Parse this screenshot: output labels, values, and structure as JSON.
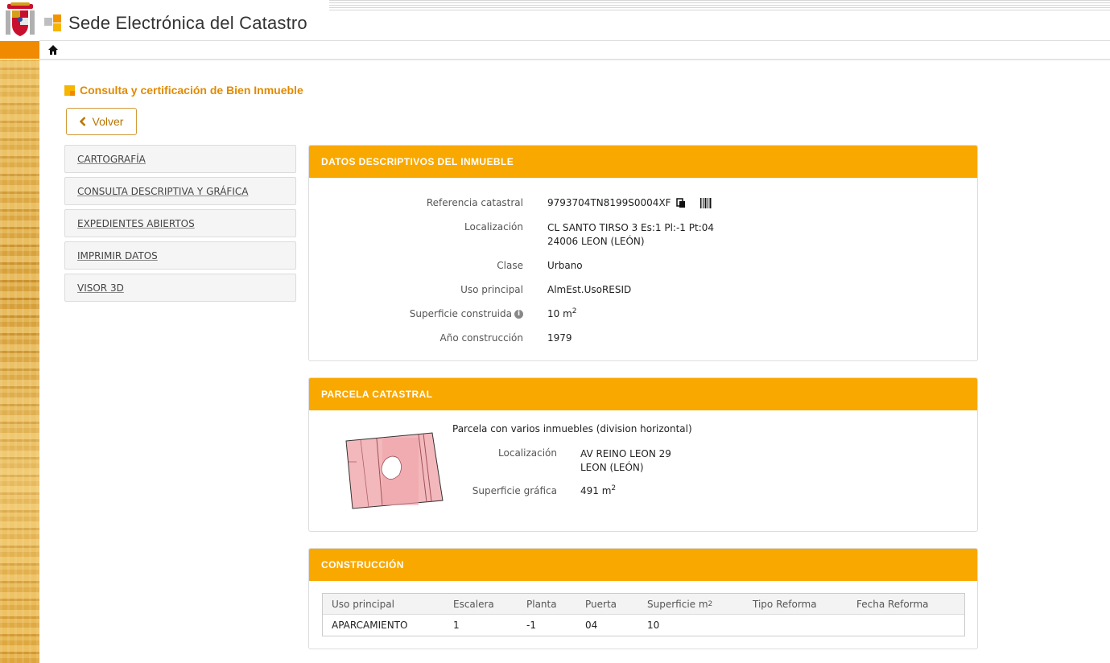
{
  "header": {
    "site_title": "Sede Electrónica del Catastro"
  },
  "page": {
    "heading": "Consulta y certificación de Bien Inmueble",
    "back_label": "Volver"
  },
  "sidebar": {
    "items": [
      {
        "label": "CARTOGRAFÍA"
      },
      {
        "label": "CONSULTA DESCRIPTIVA Y GRÁFICA"
      },
      {
        "label": "EXPEDIENTES ABIERTOS"
      },
      {
        "label": "IMPRIMIR DATOS"
      },
      {
        "label": "VISOR 3D"
      }
    ]
  },
  "datos": {
    "title": "DATOS DESCRIPTIVOS DEL INMUEBLE",
    "ref_label": "Referencia catastral",
    "ref_value": "9793704TN8199S0004XF",
    "loc_label": "Localización",
    "loc_line1": "CL SANTO TIRSO 3 Es:1 Pl:-1 Pt:04",
    "loc_line2": "24006 LEON (LEÓN)",
    "clase_label": "Clase",
    "clase_value": "Urbano",
    "uso_label": "Uso principal",
    "uso_value": "AlmEst.UsoRESID",
    "sup_label": "Superficie construida",
    "sup_value": "10 m",
    "sup_unit_exp": "2",
    "anio_label": "Año construcción",
    "anio_value": "1979"
  },
  "parcela": {
    "title": "PARCELA CATASTRAL",
    "desc": "Parcela con varios inmuebles (division horizontal)",
    "loc_label": "Localización",
    "loc_line1": "AV REINO LEON 29",
    "loc_line2": "LEON (LEÓN)",
    "sup_label": "Superficie gráfica",
    "sup_value": "491 m",
    "sup_unit_exp": "2"
  },
  "construccion": {
    "title": "CONSTRUCCIÓN",
    "columns": [
      "Uso principal",
      "Escalera",
      "Planta",
      "Puerta",
      "Superficie m",
      "Tipo Reforma",
      "Fecha Reforma"
    ],
    "sup_col_exp": "2",
    "rows": [
      [
        "APARCAMIENTO",
        "1",
        "-1",
        "04",
        "10",
        "",
        ""
      ]
    ]
  },
  "colors": {
    "accent": "#f9a800",
    "heading": "#e08a00",
    "nav_orange": "#f08a00",
    "parcel_fill": "#f2b8bc"
  },
  "icons": [
    "crest-icon",
    "catastro-logo-icon",
    "home-icon",
    "square-bullet-icon",
    "chevron-left-icon",
    "copy-icon",
    "barcode-icon",
    "info-icon"
  ]
}
